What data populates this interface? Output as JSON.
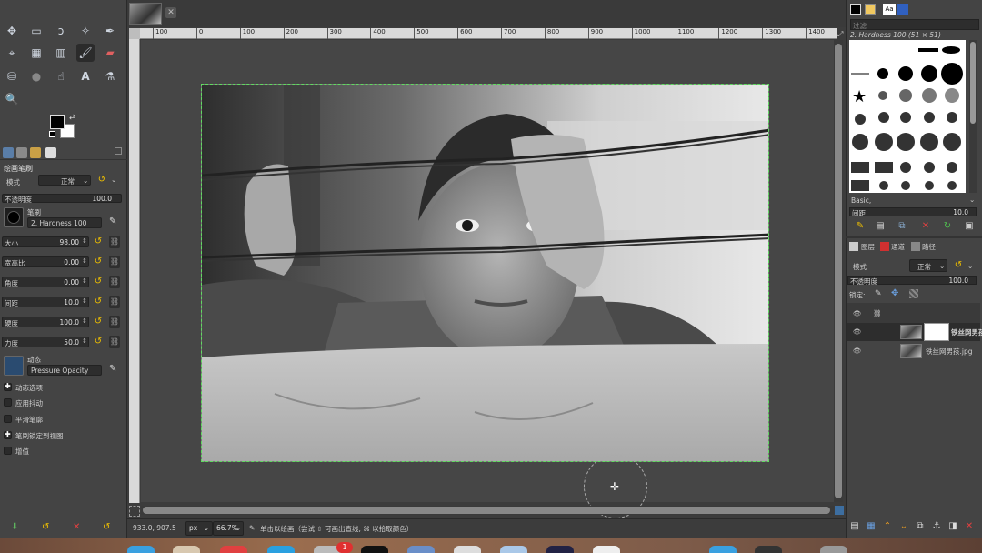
{
  "toolbox": {
    "tool_options_title": "绘画笔刷",
    "mode_label": "模式",
    "mode_value": "正常",
    "opacity_label": "不透明度",
    "opacity_value": "100.0",
    "brush_label": "笔刷",
    "brush_name": "2. Hardness 100",
    "params": [
      {
        "label": "大小",
        "value": "98.00"
      },
      {
        "label": "宽高比",
        "value": "0.00"
      },
      {
        "label": "角度",
        "value": "0.00"
      },
      {
        "label": "间距",
        "value": "10.0"
      },
      {
        "label": "硬度",
        "value": "100.0"
      },
      {
        "label": "力度",
        "value": "50.0"
      }
    ],
    "dynamics_label": "动态",
    "dynamics_value": "Pressure Opacity",
    "options": [
      {
        "label": "动态选项",
        "checked": true
      },
      {
        "label": "应用抖动",
        "checked": false
      },
      {
        "label": "平滑笔廓",
        "checked": false
      },
      {
        "label": "笔刷锁定到视图",
        "checked": true
      },
      {
        "label": "增值",
        "checked": false
      }
    ]
  },
  "ruler": {
    "top_ticks": [
      "100",
      "0",
      "100",
      "200",
      "300",
      "400",
      "500",
      "600",
      "700",
      "800",
      "900",
      "1000",
      "1100",
      "1200",
      "1300",
      "1400"
    ]
  },
  "status": {
    "coords": "933.0, 907.5",
    "unit": "px",
    "zoom": "66.7%",
    "message": "单击以绘画（尝试 ⇧ 可画出直线, ⌘ 以拾取颜色）"
  },
  "dock": {
    "filter_label": "过滤",
    "brush_title": "2. Hardness 100 (51 × 51)",
    "brush_tag": "Basic,",
    "spacing_label": "间距",
    "spacing_value": "10.0",
    "tabs": [
      "图层",
      "通道",
      "路径"
    ],
    "mode_label": "模式",
    "mode_value": "正常",
    "opacity_label": "不透明度",
    "opacity_value": "100.0",
    "lock_label": "锁定:",
    "layers": [
      {
        "name": "铁丝网男孩",
        "has_mask": true
      },
      {
        "name": "铁丝网男孩.jpg",
        "has_mask": false
      }
    ]
  },
  "macdock": {
    "badge": "1"
  },
  "colors": {
    "accent_yellow": "#f0c000",
    "selection_green": "#5fdc5f",
    "panel_bg": "#444444"
  }
}
